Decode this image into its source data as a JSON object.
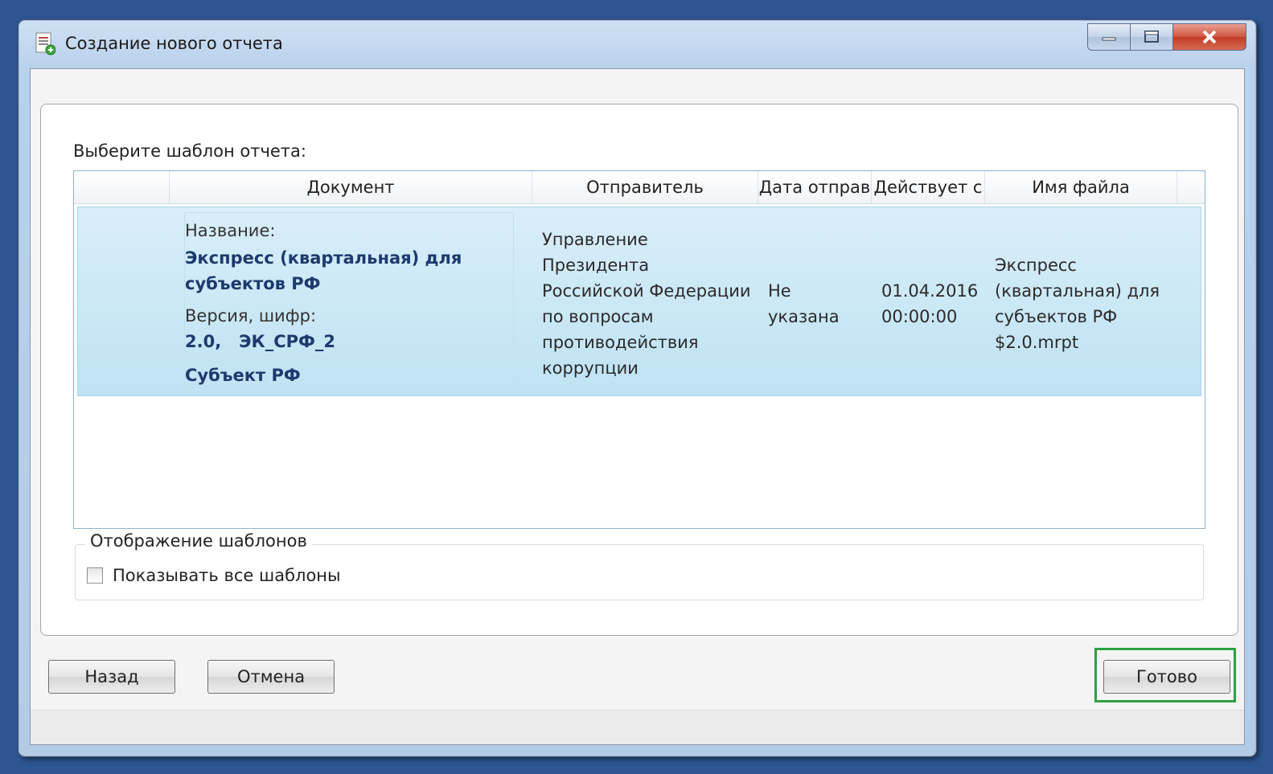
{
  "window": {
    "title": "Создание нового отчета",
    "app_icon": "document-icon"
  },
  "dialog": {
    "prompt": "Выберите шаблон отчета:",
    "columns": [
      "Документ",
      "Отправитель",
      "Дата отправ",
      "Действует с",
      "Имя файла"
    ],
    "row": {
      "doc": {
        "name_label": "Название:",
        "name_line1": "Экспресс (квартальная) для",
        "name_line2": "субъектов РФ",
        "version_label": "Версия, шифр:",
        "version_value": "2.0,   ЭК_СРФ_2",
        "subject": "Субъект РФ"
      },
      "sender": [
        "Управление",
        "Президента",
        "Российской Федерации",
        "по вопросам",
        "противодействия",
        "коррупции"
      ],
      "sent_date": [
        "Не",
        "указана"
      ],
      "effective": [
        "01.04.2016",
        "00:00:00"
      ],
      "filename": [
        "Экспресс",
        "(квартальная) для",
        "субъектов РФ",
        "$2.0.mrpt"
      ]
    },
    "group": {
      "legend": "Отображение шаблонов",
      "checkbox_label": "Показывать все шаблоны",
      "checked": false
    }
  },
  "buttons": {
    "back": "Назад",
    "cancel": "Отмена",
    "done": "Готово"
  },
  "colors": {
    "highlight": "#2ea043",
    "row_selected": "#c9e8f7",
    "desktop": "#2d5592"
  }
}
